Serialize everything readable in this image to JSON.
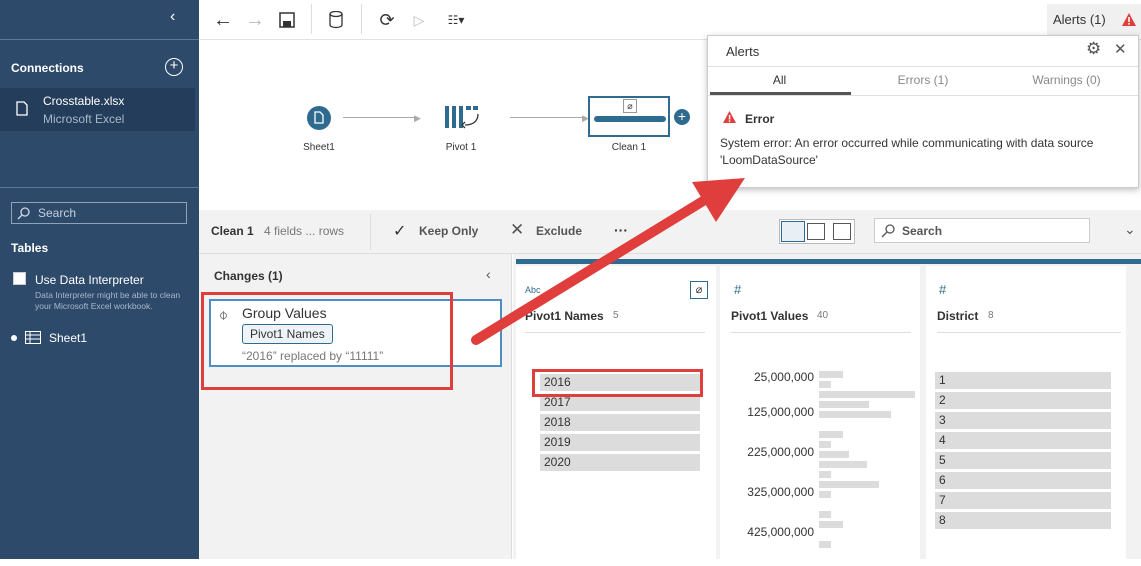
{
  "sidebar": {
    "connections_title": "Connections",
    "connection": {
      "name": "Crosstable.xlsx",
      "type": "Microsoft Excel"
    },
    "search_placeholder": "Search",
    "tables_title": "Tables",
    "interpreter_label": "Use Data Interpreter",
    "interpreter_hint": "Data Interpreter might be able to clean your Microsoft Excel workbook.",
    "table_item": "Sheet1"
  },
  "topbar": {
    "alerts_label": "Alerts (1)"
  },
  "flow": {
    "nodes": [
      {
        "label": "Sheet1"
      },
      {
        "label": "Pivot 1"
      },
      {
        "label": "Clean 1"
      }
    ]
  },
  "alerts": {
    "title": "Alerts",
    "tabs": [
      "All",
      "Errors (1)",
      "Warnings (0)"
    ],
    "error_title": "Error",
    "error_message": "System error: An error occurred while communicating with data source 'LoomDataSource'"
  },
  "toolbar": {
    "step_name": "Clean 1",
    "step_meta": "4 fields  ... rows",
    "keep_only": "Keep Only",
    "exclude": "Exclude",
    "more": "···",
    "search_placeholder": "Search"
  },
  "changes": {
    "title": "Changes (1)",
    "item_title": "Group Values",
    "item_field": "Pivot1 Names",
    "item_desc": "“2016” replaced by “11111”"
  },
  "profile": {
    "cards": [
      {
        "type_label": "Abc",
        "name": "Pivot1 Names",
        "count": "5",
        "values": [
          "2016",
          "2017",
          "2018",
          "2019",
          "2020"
        ]
      },
      {
        "type_label": "#",
        "name": "Pivot1 Values",
        "count": "40",
        "axis": [
          "25,000,000",
          "125,000,000",
          "225,000,000",
          "325,000,000",
          "425,000,000"
        ]
      },
      {
        "type_label": "#",
        "name": "District",
        "count": "8",
        "values": [
          "1",
          "2",
          "3",
          "4",
          "5",
          "6",
          "7",
          "8"
        ]
      }
    ]
  },
  "colors": {
    "sidebar": "#2e4a6b",
    "accent": "#2f6b8f",
    "error": "#e03d3d"
  }
}
